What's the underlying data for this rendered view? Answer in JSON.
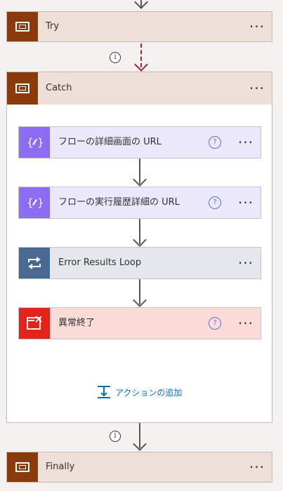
{
  "try": {
    "title": "Try",
    "more": "···"
  },
  "catch": {
    "title": "Catch",
    "more": "···",
    "actions": [
      {
        "label": "フローの詳細画面の URL",
        "help": "?",
        "more": "···",
        "color": "#8c6cf2",
        "bg": "#ece8fc",
        "icon": "expression-icon"
      },
      {
        "label": "フローの実行履歴詳細の URL",
        "help": "?",
        "more": "···",
        "color": "#8c6cf2",
        "bg": "#ece8fc",
        "icon": "expression-icon"
      },
      {
        "label": "Error Results Loop",
        "more": "···",
        "color": "#486991",
        "bg": "#e4e8ed",
        "icon": "loop-icon"
      },
      {
        "label": "異常終了",
        "help": "?",
        "more": "···",
        "color": "#e3241b",
        "bg": "#fbdcd9",
        "icon": "terminate-icon"
      }
    ],
    "add_action_label": "アクションの追加"
  },
  "finally": {
    "title": "Finally",
    "more": "···"
  },
  "info_glyph": "i",
  "colors": {
    "scope_badge": "#8b3a0b",
    "scope_bg": "#ede0d9",
    "run_after_arrow": "#a4262c"
  }
}
